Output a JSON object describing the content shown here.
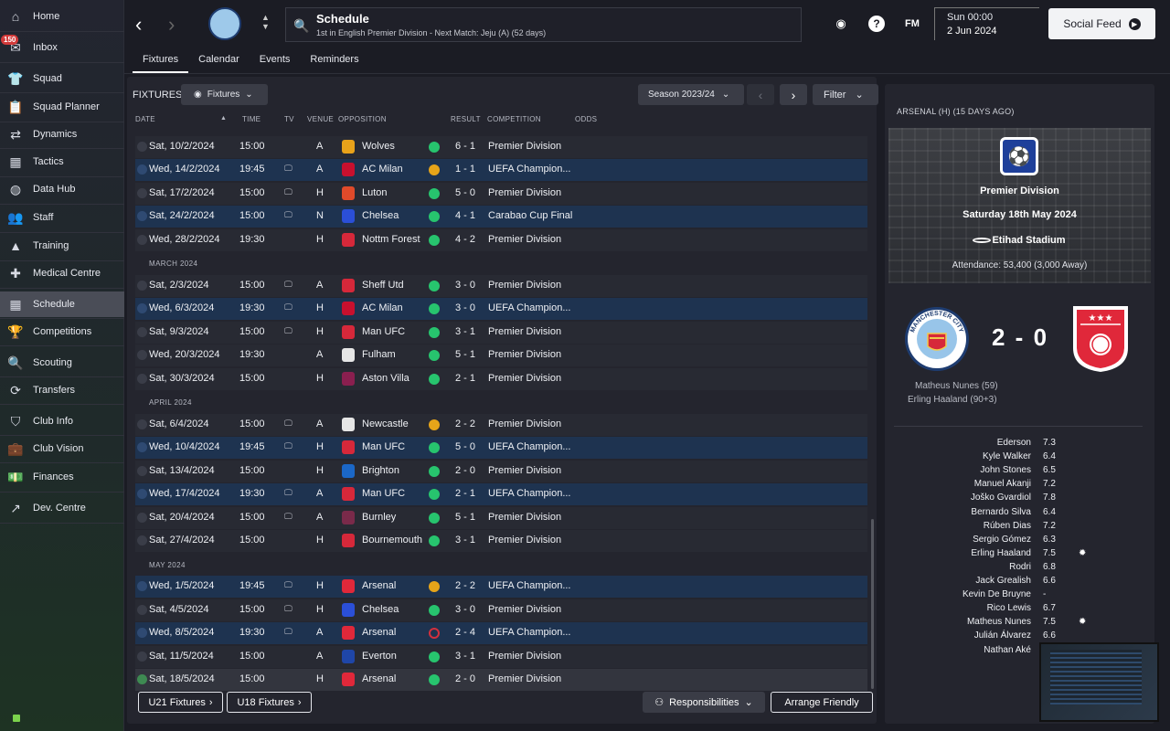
{
  "sidebar": {
    "inbox_badge": "150",
    "items": [
      {
        "label": "Home",
        "icon": "home-icon",
        "glyph": "⌂"
      },
      {
        "label": "Inbox",
        "icon": "inbox-icon",
        "glyph": "✉"
      },
      {
        "label": "Squad",
        "icon": "shirt-icon",
        "glyph": "👕"
      },
      {
        "label": "Squad Planner",
        "icon": "clipboard-icon",
        "glyph": "📋"
      },
      {
        "label": "Dynamics",
        "icon": "handshake-icon",
        "glyph": "⇄"
      },
      {
        "label": "Tactics",
        "icon": "tactics-board-icon",
        "glyph": "▦"
      },
      {
        "label": "Data Hub",
        "icon": "globe-icon",
        "glyph": "◍"
      },
      {
        "label": "Staff",
        "icon": "staff-icon",
        "glyph": "👥"
      },
      {
        "label": "Training",
        "icon": "cone-icon",
        "glyph": "▲"
      },
      {
        "label": "Medical Centre",
        "icon": "medical-icon",
        "glyph": "✚"
      },
      {
        "label": "Schedule",
        "icon": "calendar-icon",
        "glyph": "▦"
      },
      {
        "label": "Competitions",
        "icon": "trophy-icon",
        "glyph": "🏆"
      },
      {
        "label": "Scouting",
        "icon": "magnifier-icon",
        "glyph": "🔍"
      },
      {
        "label": "Transfers",
        "icon": "transfer-icon",
        "glyph": "⟳"
      },
      {
        "label": "Club Info",
        "icon": "shield-icon",
        "glyph": "⛉"
      },
      {
        "label": "Club Vision",
        "icon": "briefcase-icon",
        "glyph": "💼"
      },
      {
        "label": "Finances",
        "icon": "money-icon",
        "glyph": "💵"
      },
      {
        "label": "Dev. Centre",
        "icon": "growth-icon",
        "glyph": "↗"
      }
    ]
  },
  "header": {
    "title": "Schedule",
    "subtitle": "1st in English Premier Division - Next Match: Jeju (A) (52 days)",
    "day_time": "Sun 00:00",
    "date": "2 Jun 2024",
    "social_feed": "Social Feed",
    "fm_logo": "FM",
    "help": "?"
  },
  "tabs": [
    "Fixtures",
    "Calendar",
    "Events",
    "Reminders"
  ],
  "toolbar": {
    "fixtures_label": "FIXTURES",
    "fixtures_dropdown": "Fixtures",
    "season": "Season 2023/24",
    "filter": "Filter"
  },
  "columns": [
    "DATE",
    "TIME",
    "TV",
    "VENUE",
    "OPPOSITION",
    "RESULT",
    "COMPETITION",
    "ODDS"
  ],
  "months": [
    "MARCH 2024",
    "APRIL 2024",
    "MAY 2024"
  ],
  "fixtures": [
    {
      "date": "Sat, 10/2/2024",
      "time": "15:00",
      "tv": false,
      "venue": "A",
      "opp": "Wolves",
      "crest": "#e8a21a",
      "res": "w",
      "score": "6 - 1",
      "comp": "Premier Division",
      "style": "dark"
    },
    {
      "date": "Wed, 14/2/2024",
      "time": "19:45",
      "tv": true,
      "venue": "A",
      "opp": "AC Milan",
      "crest": "#c8102e",
      "res": "d",
      "score": "1 - 1",
      "comp": "UEFA Champion...",
      "style": "blue"
    },
    {
      "date": "Sat, 17/2/2024",
      "time": "15:00",
      "tv": true,
      "venue": "H",
      "opp": "Luton",
      "crest": "#e04a2a",
      "res": "w",
      "score": "5 - 0",
      "comp": "Premier Division",
      "style": "dark"
    },
    {
      "date": "Sat, 24/2/2024",
      "time": "15:00",
      "tv": true,
      "venue": "N",
      "opp": "Chelsea",
      "crest": "#2b4fd8",
      "res": "w",
      "score": "4 - 1",
      "comp": "Carabao Cup Final",
      "style": "blue"
    },
    {
      "date": "Wed, 28/2/2024",
      "time": "19:30",
      "tv": false,
      "venue": "H",
      "opp": "Nottm Forest",
      "crest": "#d6283a",
      "res": "w",
      "score": "4 - 2",
      "comp": "Premier Division",
      "style": "dark"
    },
    {
      "date": "Sat, 2/3/2024",
      "time": "15:00",
      "tv": true,
      "venue": "A",
      "opp": "Sheff Utd",
      "crest": "#d6283a",
      "res": "w",
      "score": "3 - 0",
      "comp": "Premier Division",
      "style": "dark"
    },
    {
      "date": "Wed, 6/3/2024",
      "time": "19:30",
      "tv": true,
      "venue": "H",
      "opp": "AC Milan",
      "crest": "#c8102e",
      "res": "w",
      "score": "3 - 0",
      "comp": "UEFA Champion...",
      "style": "blue"
    },
    {
      "date": "Sat, 9/3/2024",
      "time": "15:00",
      "tv": true,
      "venue": "H",
      "opp": "Man UFC",
      "crest": "#d6283a",
      "res": "w",
      "score": "3 - 1",
      "comp": "Premier Division",
      "style": "dark"
    },
    {
      "date": "Wed, 20/3/2024",
      "time": "19:30",
      "tv": false,
      "venue": "A",
      "opp": "Fulham",
      "crest": "#e6e6e6",
      "res": "w",
      "score": "5 - 1",
      "comp": "Premier Division",
      "style": "dark"
    },
    {
      "date": "Sat, 30/3/2024",
      "time": "15:00",
      "tv": false,
      "venue": "H",
      "opp": "Aston Villa",
      "crest": "#8a1f4f",
      "res": "w",
      "score": "2 - 1",
      "comp": "Premier Division",
      "style": "dark"
    },
    {
      "date": "Sat, 6/4/2024",
      "time": "15:00",
      "tv": true,
      "venue": "A",
      "opp": "Newcastle",
      "crest": "#e6e6e6",
      "res": "d",
      "score": "2 - 2",
      "comp": "Premier Division",
      "style": "dark"
    },
    {
      "date": "Wed, 10/4/2024",
      "time": "19:45",
      "tv": true,
      "venue": "H",
      "opp": "Man UFC",
      "crest": "#d6283a",
      "res": "w",
      "score": "5 - 0",
      "comp": "UEFA Champion...",
      "style": "blue"
    },
    {
      "date": "Sat, 13/4/2024",
      "time": "15:00",
      "tv": false,
      "venue": "H",
      "opp": "Brighton",
      "crest": "#1b67c7",
      "res": "w",
      "score": "2 - 0",
      "comp": "Premier Division",
      "style": "dark"
    },
    {
      "date": "Wed, 17/4/2024",
      "time": "19:30",
      "tv": true,
      "venue": "A",
      "opp": "Man UFC",
      "crest": "#d6283a",
      "res": "w",
      "score": "2 - 1",
      "comp": "UEFA Champion...",
      "style": "blue"
    },
    {
      "date": "Sat, 20/4/2024",
      "time": "15:00",
      "tv": true,
      "venue": "A",
      "opp": "Burnley",
      "crest": "#7a2a4a",
      "res": "w",
      "score": "5 - 1",
      "comp": "Premier Division",
      "style": "dark"
    },
    {
      "date": "Sat, 27/4/2024",
      "time": "15:00",
      "tv": false,
      "venue": "H",
      "opp": "Bournemouth",
      "crest": "#d6283a",
      "res": "w",
      "score": "3 - 1",
      "comp": "Premier Division",
      "style": "dark"
    },
    {
      "date": "Wed, 1/5/2024",
      "time": "19:45",
      "tv": true,
      "venue": "H",
      "opp": "Arsenal",
      "crest": "#e0283a",
      "res": "d",
      "score": "2 - 2",
      "comp": "UEFA Champion...",
      "style": "blue"
    },
    {
      "date": "Sat, 4/5/2024",
      "time": "15:00",
      "tv": true,
      "venue": "H",
      "opp": "Chelsea",
      "crest": "#2b4fd8",
      "res": "w",
      "score": "3 - 0",
      "comp": "Premier Division",
      "style": "dark"
    },
    {
      "date": "Wed, 8/5/2024",
      "time": "19:30",
      "tv": true,
      "venue": "A",
      "opp": "Arsenal",
      "crest": "#e0283a",
      "res": "l",
      "score": "2 - 4",
      "comp": "UEFA Champion...",
      "style": "blue"
    },
    {
      "date": "Sat, 11/5/2024",
      "time": "15:00",
      "tv": false,
      "venue": "A",
      "opp": "Everton",
      "crest": "#1f46a8",
      "res": "w",
      "score": "3 - 1",
      "comp": "Premier Division",
      "style": "dark"
    },
    {
      "date": "Sat, 18/5/2024",
      "time": "15:00",
      "tv": false,
      "venue": "H",
      "opp": "Arsenal",
      "crest": "#e0283a",
      "res": "w",
      "score": "2 - 0",
      "comp": "Premier Division",
      "style": "last",
      "done": true
    }
  ],
  "bottom_buttons": {
    "u21": "U21 Fixtures",
    "u18": "U18 Fixtures",
    "responsibilities": "Responsibilities",
    "arrange": "Arrange Friendly"
  },
  "match_panel": {
    "heading": "ARSENAL (H) (15 DAYS AGO)",
    "competition": "Premier Division",
    "date": "Saturday 18th May 2024",
    "stadium": "Etihad Stadium",
    "attendance": "Attendance: 53,400 (3,000 Away)",
    "score": "2 - 0",
    "home_badge_text": "MANCHESTER CITY",
    "scorers": [
      "Matheus Nunes (59)",
      "Erling Haaland (90+3)"
    ],
    "players": [
      {
        "name": "Ederson",
        "rating": "7.3",
        "star": false
      },
      {
        "name": "Kyle Walker",
        "rating": "6.4",
        "star": false
      },
      {
        "name": "John Stones",
        "rating": "6.5",
        "star": false
      },
      {
        "name": "Manuel Akanji",
        "rating": "7.2",
        "star": false
      },
      {
        "name": "Joško Gvardiol",
        "rating": "7.8",
        "star": false
      },
      {
        "name": "Bernardo Silva",
        "rating": "6.4",
        "star": false
      },
      {
        "name": "Rúben Dias",
        "rating": "7.2",
        "star": false
      },
      {
        "name": "Sergio Gómez",
        "rating": "6.3",
        "star": false
      },
      {
        "name": "Erling Haaland",
        "rating": "7.5",
        "star": true
      },
      {
        "name": "Rodri",
        "rating": "6.8",
        "star": false
      },
      {
        "name": "Jack Grealish",
        "rating": "6.6",
        "star": false
      },
      {
        "name": "Kevin De Bruyne",
        "rating": "-",
        "star": false
      },
      {
        "name": "Rico Lewis",
        "rating": "6.7",
        "star": false
      },
      {
        "name": "Matheus Nunes",
        "rating": "7.5",
        "star": true
      },
      {
        "name": "Julián Álvarez",
        "rating": "6.6",
        "star": false
      },
      {
        "name": "Nathan Aké",
        "rating": "",
        "star": false
      }
    ]
  },
  "colors": {
    "win": "#27c46e",
    "draw": "#e6a419",
    "loss": "#d3303d",
    "accent_blue": "#1e3350"
  }
}
